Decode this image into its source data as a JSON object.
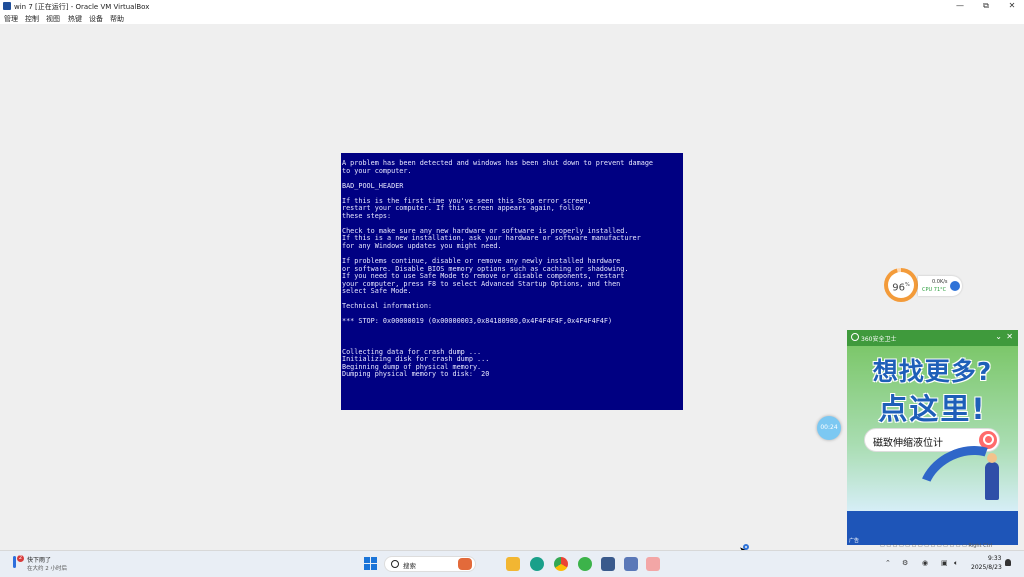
{
  "window": {
    "title": "win 7 [正在运行] - Oracle VM VirtualBox",
    "controls": {
      "minimize": "—",
      "maximize": "⧉",
      "close": "✕"
    }
  },
  "menubar": [
    "管理",
    "控制",
    "视图",
    "热键",
    "设备",
    "帮助"
  ],
  "bsod": {
    "lines": [
      "A problem has been detected and windows has been shut down to prevent damage",
      "to your computer.",
      "",
      "BAD_POOL_HEADER",
      "",
      "If this is the first time you've seen this Stop error screen,",
      "restart your computer. If this screen appears again, follow",
      "these steps:",
      "",
      "Check to make sure any new hardware or software is properly installed.",
      "If this is a new installation, ask your hardware or software manufacturer",
      "for any Windows updates you might need.",
      "",
      "If problems continue, disable or remove any newly installed hardware",
      "or software. Disable BIOS memory options such as caching or shadowing.",
      "If you need to use Safe Mode to remove or disable components, restart",
      "your computer, press F8 to select Advanced Startup Options, and then",
      "select Safe Mode.",
      "",
      "Technical information:",
      "",
      "*** STOP: 0x00000019 (0x00000003,0x84180980,0x4F4F4F4F,0x4F4F4F4F)",
      "",
      "",
      "",
      "Collecting data for crash dump ...",
      "Initializing disk for crash dump ...",
      "Beginning dump of physical memory.",
      "Dumping physical memory to disk:  20"
    ],
    "colors": {
      "background": "#000082",
      "text": "#e8e8ff"
    }
  },
  "monitor": {
    "percent": "96",
    "percent_unit": "%",
    "net_speed": "0.0K/s",
    "cpu_label": "CPU",
    "cpu_temp": "71°C"
  },
  "ad": {
    "brand": "360安全卫士",
    "headline1": "想找更多?",
    "headline2": "点这里!",
    "search_text": "磁致伸缩液位计",
    "badge": "广告",
    "chevron": "⌄",
    "close": "✕"
  },
  "bubble": {
    "text": "00:24"
  },
  "tray_strip": "▭ ▭ ▭ ▭ ▭ ▭ ▭ ▭ ▭ ▭ ▭ ▭ ▭ ▭ Right Ctrl",
  "taskbar": {
    "weather_badge": "2",
    "weather_title": "快下雨了",
    "weather_sub": "在大约 2 小时后",
    "search_label": "搜索",
    "clock_time": "9:33",
    "clock_date": "2025/8/23",
    "tray_icons": [
      "chevron-up-icon",
      "network-icon",
      "wechat-icon",
      "display-icon",
      "volume-icon",
      "bell-icon"
    ]
  }
}
